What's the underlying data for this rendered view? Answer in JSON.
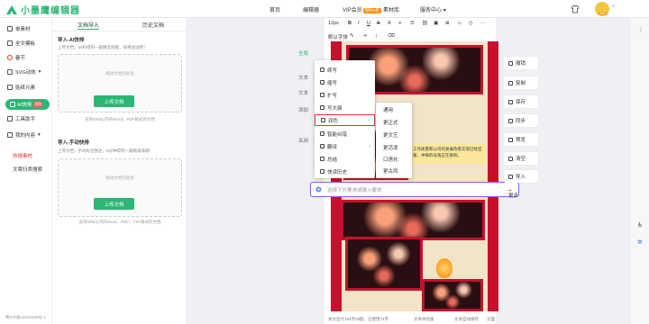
{
  "topbar": {
    "logo_text": "小墨鹰编辑器",
    "nav": {
      "home": "首页",
      "editor": "编辑器",
      "vip": "VIP会员",
      "vip_badge": "限时5折",
      "materials": "素材库",
      "service": "服务中心"
    },
    "user_tag": "VIP"
  },
  "sidebar": {
    "items": [
      {
        "label": "单素材",
        "icon": "single-material-icon"
      },
      {
        "label": "全文模板",
        "icon": "template-icon"
      },
      {
        "label": "春节",
        "icon": "festival-icon"
      },
      {
        "label": "SVG动效",
        "icon": "svg-icon"
      },
      {
        "label": "贴纸元素",
        "icon": "sticker-icon"
      },
      {
        "label": "AI快排",
        "icon": "ai-icon",
        "badge": "限免"
      },
      {
        "label": "工具助手",
        "icon": "tools-icon"
      },
      {
        "label": "我的内容",
        "icon": "my-content-icon"
      }
    ],
    "link_red": "热搜素材",
    "link_search": "文章归类搜索",
    "icp": "粤ICP备16024499号-1"
  },
  "import_panel": {
    "tab_import": "文档导入",
    "tab_history": "历史文档",
    "ai": {
      "title": "导入-AI快排",
      "subtitle": "上传文档，30秒得到一篇精美排版，快来试试吧！",
      "hint": "拖动文档到此处",
      "button": "上传文档",
      "support": "支持20M以内的Word、PDF格式的文档"
    },
    "manual": {
      "title": "导入-手动快排",
      "subtitle": "上传文档，手动标注图注，5分钟得到一篇精美排版！",
      "hint": "拖动文档到此处",
      "button": "上传文档",
      "support": "支持20M以内的Word、PDF、TXT格式的文档"
    }
  },
  "editor": {
    "font_size": "12px",
    "font_family": "默认字体",
    "highlight_text": "工作质量和公司的发展改善实现已经显著，冲锋的号角正在奏响。",
    "status_left": "本文合计194字29图，已使用74字",
    "status_mid": "文本体验版",
    "status_right": "文本自动保存",
    "status_page": "页面"
  },
  "left_pills": {
    "full": "全局",
    "text1": "文本",
    "text2": "文本",
    "add": "添加",
    "close": "关闭"
  },
  "context_menu": {
    "items": [
      {
        "label": "续写",
        "icon": "pen-icon"
      },
      {
        "label": "缩写",
        "icon": "shrink-icon"
      },
      {
        "label": "扩写",
        "icon": "expand-icon"
      },
      {
        "label": "写大纲",
        "icon": "outline-icon"
      },
      {
        "label": "润色",
        "icon": "polish-icon",
        "has_sub": true
      },
      {
        "label": "智能纠错",
        "icon": "check-icon"
      },
      {
        "label": "翻译",
        "icon": "translate-icon",
        "has_sub": true
      },
      {
        "label": "总结",
        "icon": "summary-icon"
      },
      {
        "label": "快读历史",
        "icon": "history-icon"
      }
    ],
    "submenu": [
      "通用",
      "更正式",
      "更文艺",
      "更活泼",
      "口语化",
      "更古风"
    ]
  },
  "ai_input": {
    "placeholder": "选择下方要求或输入要求"
  },
  "right_toolbar": {
    "items": [
      "撤销",
      "复制",
      "保存",
      "同步",
      "预览",
      "清空",
      "导入",
      "更多"
    ]
  }
}
